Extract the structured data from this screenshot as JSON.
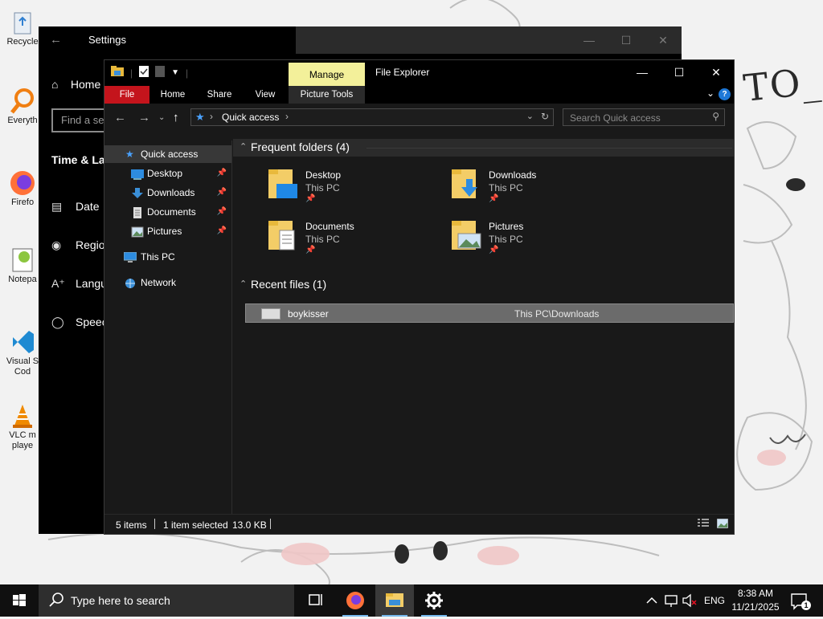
{
  "desktop": {
    "icons": [
      {
        "label": "Recycle",
        "icon": "recycle-bin-icon"
      },
      {
        "label": "Everyth",
        "icon": "everything-search-icon"
      },
      {
        "label": "Firefo",
        "icon": "firefox-icon"
      },
      {
        "label": "Notepa",
        "icon": "notepad-plus-plus-icon"
      },
      {
        "label": "Visual S\nCod",
        "icon": "vscode-icon"
      },
      {
        "label": "VLC m\nplaye",
        "icon": "vlc-icon"
      }
    ],
    "wallpaper_text": "TO_"
  },
  "settings": {
    "title": "Settings",
    "home_label": "Home",
    "find_placeholder": "Find a se",
    "section_title": "Time & La",
    "nav_items": [
      {
        "label": "Date ",
        "icon": "calendar-clock-icon"
      },
      {
        "label": "Regio",
        "icon": "globe-icon"
      },
      {
        "label": "Langu",
        "icon": "language-icon"
      },
      {
        "label": "Speec",
        "icon": "microphone-icon"
      }
    ]
  },
  "explorer": {
    "title": "File Explorer",
    "manage_label": "Manage",
    "ribbon_tabs": [
      "File",
      "Home",
      "Share",
      "View",
      "Picture Tools"
    ],
    "address": {
      "location": "Quick access"
    },
    "search_placeholder": "Search Quick access",
    "nav_pane": [
      {
        "label": "Quick access",
        "icon": "star-icon",
        "pinned": false,
        "selected": true
      },
      {
        "label": "Desktop",
        "icon": "desktop-folder-icon",
        "pinned": true
      },
      {
        "label": "Downloads",
        "icon": "downloads-icon",
        "pinned": true
      },
      {
        "label": "Documents",
        "icon": "documents-icon",
        "pinned": true
      },
      {
        "label": "Pictures",
        "icon": "pictures-icon",
        "pinned": true
      },
      {
        "label": "This PC",
        "icon": "this-pc-icon",
        "pinned": false
      },
      {
        "label": "Network",
        "icon": "network-icon",
        "pinned": false
      }
    ],
    "frequent_header": "Frequent folders (4)",
    "frequent_folders": [
      {
        "name": "Desktop",
        "location": "This PC",
        "icon": "desktop-folder-icon"
      },
      {
        "name": "Downloads",
        "location": "This PC",
        "icon": "downloads-folder-icon"
      },
      {
        "name": "Documents",
        "location": "This PC",
        "icon": "documents-folder-icon"
      },
      {
        "name": "Pictures",
        "location": "This PC",
        "icon": "pictures-folder-icon"
      }
    ],
    "recent_header": "Recent files (1)",
    "recent_files": [
      {
        "name": "boykisser",
        "path": "This PC\\Downloads"
      }
    ],
    "status": {
      "items": "5 items",
      "selected": "1 item selected",
      "size": "13.0 KB"
    }
  },
  "taskbar": {
    "search_placeholder": "Type here to search",
    "pinned": [
      "task-view-icon",
      "firefox-icon",
      "file-explorer-icon",
      "settings-gear-icon"
    ],
    "language": "ENG",
    "time": "8:38 AM",
    "date": "11/21/2025",
    "notification_count": "1"
  },
  "colors": {
    "file_tab": "#c4141c",
    "manage_tab": "#f3f09a",
    "accent": "#76b9ed",
    "dark_bg": "#191919"
  }
}
